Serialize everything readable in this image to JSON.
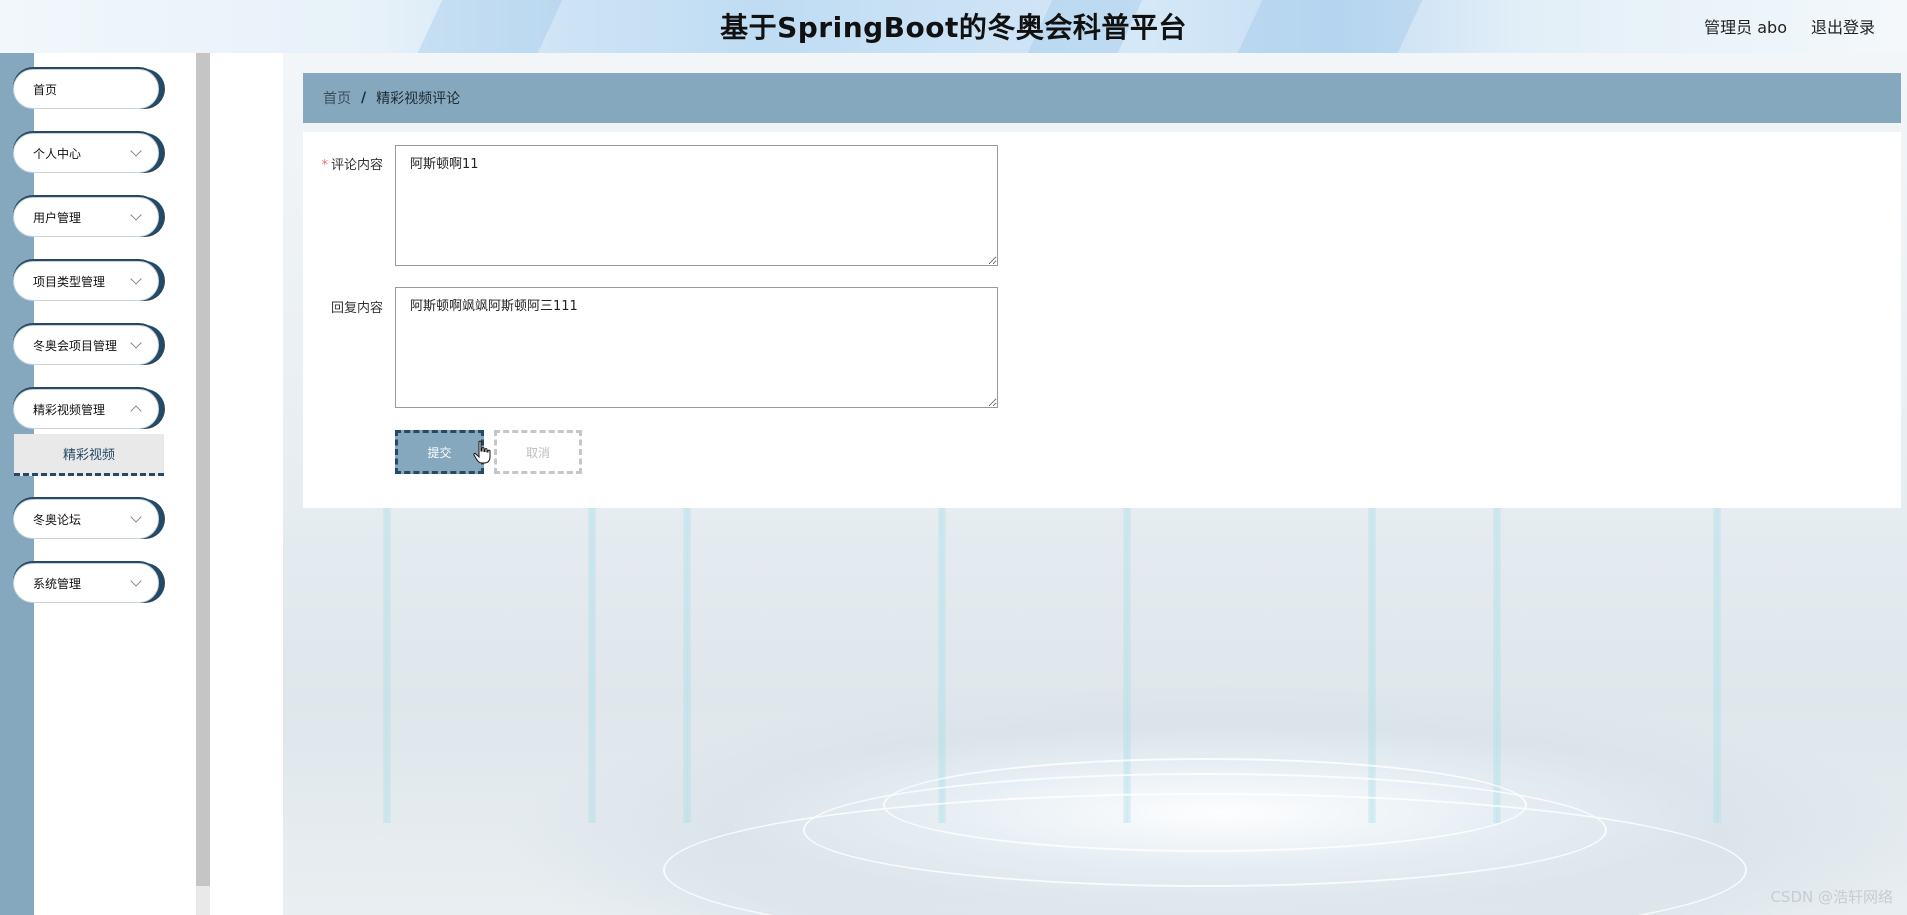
{
  "header": {
    "title": "基于SpringBoot的冬奥会科普平台",
    "user": "管理员 abo",
    "logout": "退出登录"
  },
  "sidebar": {
    "items": [
      {
        "label": "首页",
        "has_chevron": false
      },
      {
        "label": "个人中心",
        "has_chevron": true
      },
      {
        "label": "用户管理",
        "has_chevron": true
      },
      {
        "label": "项目类型管理",
        "has_chevron": true
      },
      {
        "label": "冬奥会项目管理",
        "has_chevron": true
      },
      {
        "label": "精彩视频管理",
        "has_chevron": true,
        "expanded": true
      },
      {
        "label": "冬奥论坛",
        "has_chevron": true
      },
      {
        "label": "系统管理",
        "has_chevron": true
      }
    ],
    "subitem": "精彩视频"
  },
  "breadcrumb": {
    "home": "首页",
    "separator": "/",
    "current": "精彩视频评论"
  },
  "form": {
    "comment_label": "评论内容",
    "comment_required_mark": "*",
    "comment_value": "阿斯顿啊11",
    "reply_label": "回复内容",
    "reply_value": "阿斯顿啊飒飒阿斯顿阿三111",
    "submit_label": "提交",
    "cancel_label": "取消"
  },
  "watermark": "CSDN @浩轩网络",
  "colors": {
    "accent": "#85a8bf",
    "dark_accent": "#264a66",
    "required": "#f56c6c"
  }
}
